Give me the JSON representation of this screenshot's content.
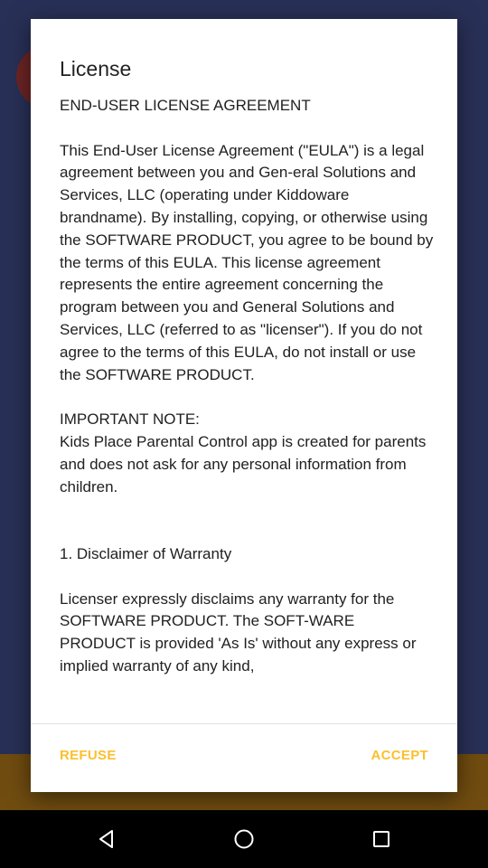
{
  "dialog": {
    "title": "License",
    "body": [
      "END-USER LICENSE AGREEMENT",
      "",
      "This End-User License Agreement (\"EULA\") is a legal agreement between you and Gen-eral Solutions and Services, LLC (operating under Kiddoware brandname). By installing, copying, or otherwise using the SOFTWARE PRODUCT, you agree to be bound by the terms of this EULA. This license agreement represents the entire agreement concerning the program between you and General Solutions and Services, LLC (referred to as \"licenser\"). If you do not agree to the terms of this EULA, do not install or use the SOFTWARE PRODUCT.",
      "",
      "IMPORTANT NOTE:",
      "Kids Place Parental Control app is created for parents and does not ask for any personal information from children.",
      "",
      "",
      "1. Disclaimer of Warranty",
      "",
      "Licenser expressly disclaims any warranty for the SOFTWARE PRODUCT. The SOFT-WARE PRODUCT is provided 'As Is' without any express or implied warranty of any kind,"
    ],
    "refuse_label": "REFUSE",
    "accept_label": "ACCEPT"
  },
  "navbar": {
    "back_icon": "back-triangle-icon",
    "home_icon": "home-circle-icon",
    "recent_icon": "recent-apps-square-icon"
  },
  "colors": {
    "accent": "#fbc02d",
    "dialog_bg": "#ffffff",
    "navbar_bg": "#000000"
  }
}
